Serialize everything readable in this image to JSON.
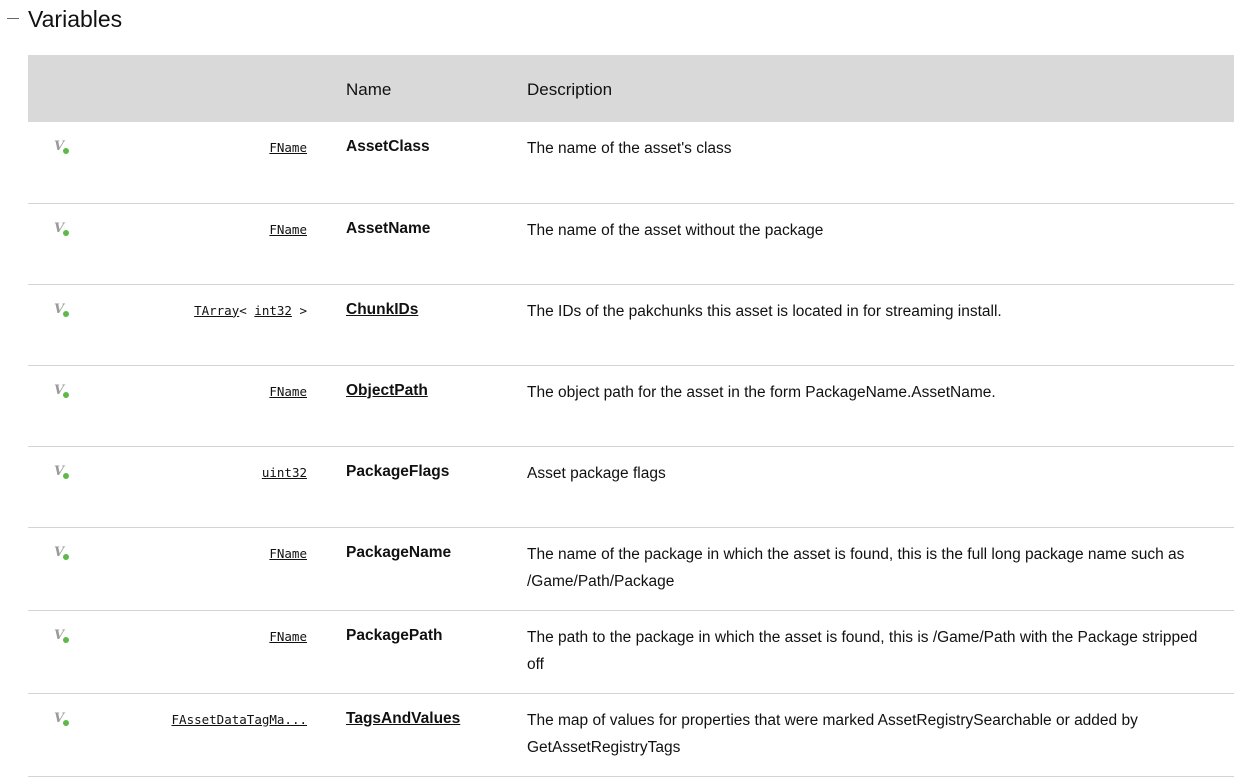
{
  "section": {
    "title": "Variables",
    "toggle_symbol": "−"
  },
  "table": {
    "headers": {
      "icon": "",
      "type": "",
      "name": "Name",
      "description": "Description"
    },
    "rows": [
      {
        "type_parts": [
          {
            "text": "FName",
            "link": true
          }
        ],
        "name": "AssetClass",
        "name_link": false,
        "description": "The name of the asset's class"
      },
      {
        "type_parts": [
          {
            "text": "FName",
            "link": true
          }
        ],
        "name": "AssetName",
        "name_link": false,
        "description": "The name of the asset without the package"
      },
      {
        "type_parts": [
          {
            "text": "TArray",
            "link": true
          },
          {
            "text": "< ",
            "link": false
          },
          {
            "text": "int32",
            "link": true
          },
          {
            "text": " >",
            "link": false
          }
        ],
        "name": "ChunkIDs",
        "name_link": true,
        "description": "The IDs of the pakchunks this asset is located in for streaming install."
      },
      {
        "type_parts": [
          {
            "text": "FName",
            "link": true
          }
        ],
        "name": "ObjectPath",
        "name_link": true,
        "description": "The object path for the asset in the form PackageName.AssetName."
      },
      {
        "type_parts": [
          {
            "text": "uint32",
            "link": true
          }
        ],
        "name": "PackageFlags",
        "name_link": false,
        "description": "Asset package flags"
      },
      {
        "type_parts": [
          {
            "text": "FName",
            "link": true
          }
        ],
        "name": "PackageName",
        "name_link": false,
        "description": "The name of the package in which the asset is found, this is the full long package name such as /Game/Path/Package"
      },
      {
        "type_parts": [
          {
            "text": "FName",
            "link": true
          }
        ],
        "name": "PackagePath",
        "name_link": false,
        "description": "The path to the package in which the asset is found, this is /Game/Path with the Package stripped off"
      },
      {
        "type_parts": [
          {
            "text": "FAssetDataTagMa...",
            "link": true
          }
        ],
        "name": "TagsAndValues",
        "name_link": true,
        "description": "The map of values for properties that were marked AssetRegistrySearchable or added by GetAssetRegistryTags"
      }
    ]
  },
  "colors": {
    "header_bg": "#d9d9d9",
    "row_border": "#d4d4d4",
    "icon_dot": "#5fb84a",
    "icon_letter": "#9a9a9a"
  },
  "icons": {
    "variable": "public-variable-icon",
    "toggle": "collapse-minus-icon"
  }
}
